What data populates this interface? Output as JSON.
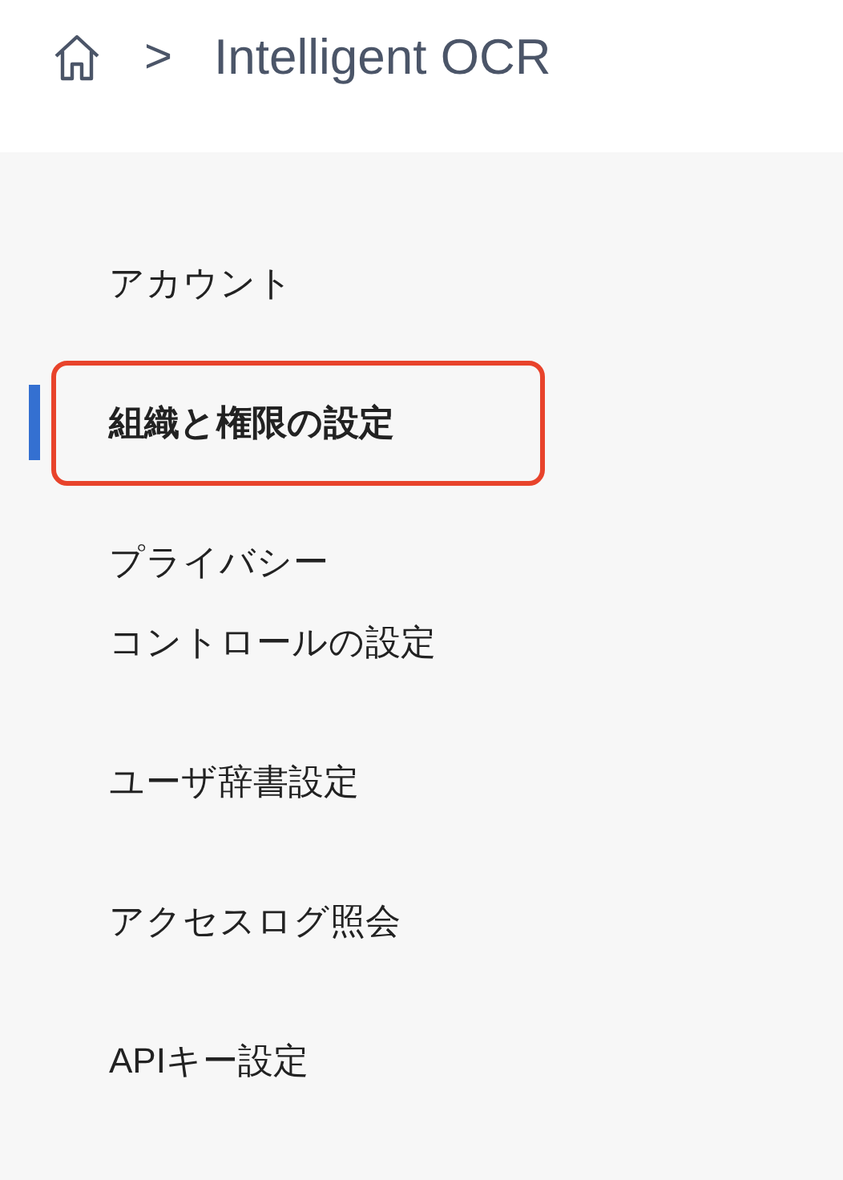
{
  "breadcrumb": {
    "separator": ">",
    "title": "Intelligent OCR"
  },
  "sidebar": {
    "items": [
      {
        "lines": [
          "アカウント"
        ],
        "selected": false,
        "highlighted": false
      },
      {
        "lines": [
          "組織と権限の設定"
        ],
        "selected": true,
        "highlighted": true
      },
      {
        "lines": [
          "プライバシー",
          "コントロールの設定"
        ],
        "selected": false,
        "highlighted": false
      },
      {
        "lines": [
          "ユーザ辞書設定"
        ],
        "selected": false,
        "highlighted": false
      },
      {
        "lines": [
          "アクセスログ照会"
        ],
        "selected": false,
        "highlighted": false
      },
      {
        "lines": [
          "APIキー設定"
        ],
        "selected": false,
        "highlighted": false
      }
    ]
  }
}
